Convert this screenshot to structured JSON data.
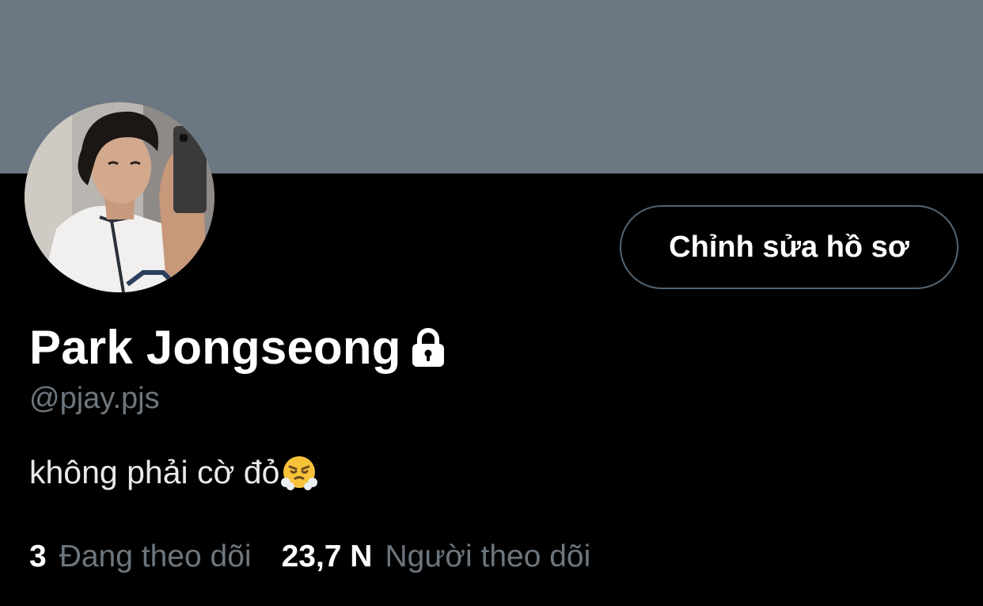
{
  "colors": {
    "banner": "#6b7783",
    "background": "#000000",
    "secondary_text": "#6e767d",
    "button_border": "#536471"
  },
  "profile": {
    "avatar_icon": "profile-photo",
    "display_name": "Park Jongseong",
    "protected_icon": "lock-icon",
    "handle": "@pjay.pjs",
    "bio_text": "không phải cờ đỏ",
    "bio_emoji": "face-with-steam-from-nose"
  },
  "actions": {
    "edit_profile_label": "Chỉnh sửa hồ sơ"
  },
  "stats": {
    "following_count": "3",
    "following_label": "Đang theo dõi",
    "followers_count": "23,7 N",
    "followers_label": "Người theo dõi"
  }
}
